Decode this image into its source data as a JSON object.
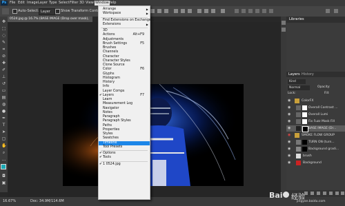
{
  "menubar": {
    "items": [
      "File",
      "Edit",
      "Image",
      "Layer",
      "Type",
      "Select",
      "Filter",
      "3D",
      "View",
      "Window",
      "Help"
    ],
    "active": "Window"
  },
  "options_bar": {
    "auto_select_label": "Auto-Select:",
    "auto_select_value": "Layer",
    "transform_label": "Show Transform Controls"
  },
  "document_tab": "0524.jpg @ 16.7% (BASE IMAGE (Drop over mask), RGB/8#)",
  "window_menu": [
    {
      "label": "Arrange",
      "submenu": true
    },
    {
      "label": "Workspace",
      "submenu": true
    },
    {
      "sep": true
    },
    {
      "label": "Find Extensions on Exchange..."
    },
    {
      "label": "Extensions",
      "submenu": true
    },
    {
      "sep": true
    },
    {
      "label": "3D"
    },
    {
      "label": "Actions",
      "shortcut": "Alt+F9"
    },
    {
      "label": "Adjustments"
    },
    {
      "label": "Brush Settings",
      "shortcut": "F5"
    },
    {
      "label": "Brushes"
    },
    {
      "label": "Channels"
    },
    {
      "label": "Character"
    },
    {
      "label": "Character Styles"
    },
    {
      "label": "Clone Source"
    },
    {
      "label": "Color",
      "shortcut": "F6"
    },
    {
      "label": "Glyphs"
    },
    {
      "label": "Histogram"
    },
    {
      "label": "History"
    },
    {
      "label": "Info"
    },
    {
      "label": "Layer Comps"
    },
    {
      "label": "Layers",
      "shortcut": "F7",
      "checked": true
    },
    {
      "label": "Learn"
    },
    {
      "label": "Measurement Log"
    },
    {
      "label": "Navigator"
    },
    {
      "label": "Notes"
    },
    {
      "label": "Paragraph"
    },
    {
      "label": "Paragraph Styles"
    },
    {
      "label": "Paths"
    },
    {
      "label": "Properties"
    },
    {
      "label": "Styles"
    },
    {
      "label": "Swatches"
    },
    {
      "label": "Timeline",
      "highlighted": true
    },
    {
      "label": "Tool Presets"
    },
    {
      "sep": true
    },
    {
      "label": "Options",
      "checked": true
    },
    {
      "label": "Tools",
      "checked": true
    },
    {
      "sep": true
    },
    {
      "label": "1 0524.jpg",
      "checked": true
    }
  ],
  "panels": {
    "top_tab": "Libraries",
    "layers_tab": "Layers",
    "history_tab": "History",
    "filter_label": "Kind",
    "blend_mode": "Normal",
    "lock_label": "Lock:",
    "opacity_label": "Opacity:",
    "fill_label": "Fill:"
  },
  "layers": [
    {
      "name": "ColorFX",
      "type": "group"
    },
    {
      "name": "Overall Contrast ..."
    },
    {
      "name": "Overall Lumi"
    },
    {
      "name": "Fix Fuzz Mask Fill"
    },
    {
      "name": "BASE IMAGE (Dr...",
      "selected": true
    },
    {
      "name": "SMOKE FLOW GROUP",
      "type": "group"
    },
    {
      "name": "TURN ON (turn..."
    },
    {
      "name": "Background gradi..."
    },
    {
      "name": "brush"
    },
    {
      "name": "Background"
    }
  ],
  "status": {
    "zoom": "16.67%",
    "doc": "Doc: 34.9M/114.6M"
  },
  "watermark": {
    "brand": "Bai",
    "brand2": "经验",
    "domain": "jingyan.baidu.com"
  },
  "colors": {
    "menu_highlight": "#1c86e8",
    "layer_selected": "#5c5c5c",
    "foreground_swatch": "#1aa9b4"
  }
}
